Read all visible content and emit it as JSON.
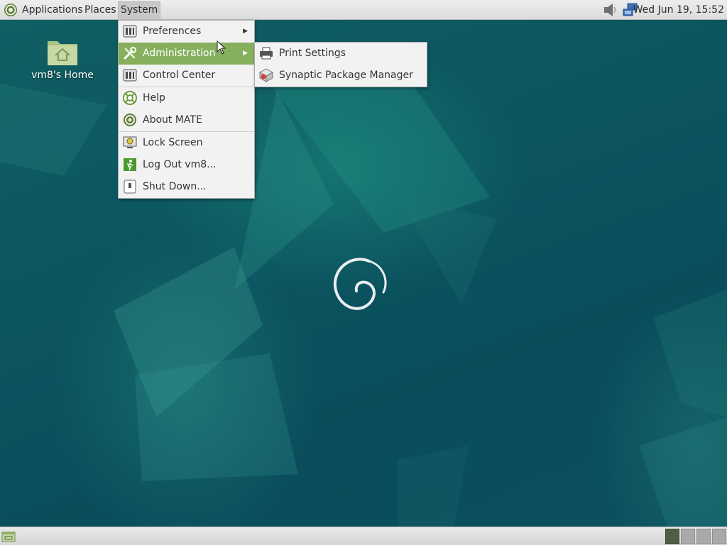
{
  "top_panel": {
    "menus": [
      {
        "label": "Applications"
      },
      {
        "label": "Places"
      },
      {
        "label": "System"
      }
    ],
    "clock": "Wed Jun 19, 15:52",
    "tray_icons": [
      "volume-icon",
      "network-icon"
    ]
  },
  "desktop": {
    "icons": [
      {
        "label": "vm8's Home",
        "icon": "home-folder-icon"
      }
    ]
  },
  "system_menu": {
    "items": [
      {
        "label": "Preferences",
        "icon": "preferences-icon",
        "submenu": true
      },
      {
        "label": "Administration",
        "icon": "administration-icon",
        "submenu": true,
        "highlighted": true
      },
      {
        "label": "Control Center",
        "icon": "control-center-icon"
      },
      {
        "label": "Help",
        "icon": "help-icon"
      },
      {
        "label": "About MATE",
        "icon": "mate-icon"
      },
      {
        "label": "Lock Screen",
        "icon": "lock-screen-icon"
      },
      {
        "label": "Log Out vm8...",
        "icon": "logout-icon"
      },
      {
        "label": "Shut Down...",
        "icon": "shutdown-icon"
      }
    ]
  },
  "administration_submenu": {
    "items": [
      {
        "label": "Print Settings",
        "icon": "printer-icon"
      },
      {
        "label": "Synaptic Package Manager",
        "icon": "synaptic-icon"
      }
    ]
  },
  "bottom_panel": {
    "workspaces": 4,
    "current_workspace": 1
  },
  "colors": {
    "menu_highlight": "#86b05d",
    "desktop_bg": "#0b5560",
    "panel_bg": "#e4e4e4"
  }
}
